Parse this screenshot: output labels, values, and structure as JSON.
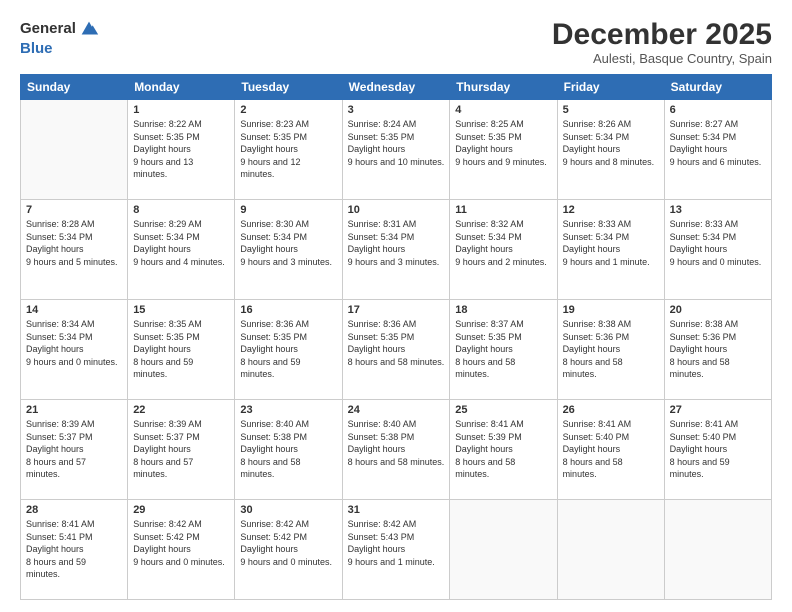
{
  "header": {
    "logo_line1": "General",
    "logo_line2": "Blue",
    "month_title": "December 2025",
    "subtitle": "Aulesti, Basque Country, Spain"
  },
  "weekdays": [
    "Sunday",
    "Monday",
    "Tuesday",
    "Wednesday",
    "Thursday",
    "Friday",
    "Saturday"
  ],
  "weeks": [
    [
      {
        "day": "",
        "sunrise": "",
        "sunset": "",
        "daylight": ""
      },
      {
        "day": "1",
        "sunrise": "8:22 AM",
        "sunset": "5:35 PM",
        "daylight": "9 hours and 13 minutes."
      },
      {
        "day": "2",
        "sunrise": "8:23 AM",
        "sunset": "5:35 PM",
        "daylight": "9 hours and 12 minutes."
      },
      {
        "day": "3",
        "sunrise": "8:24 AM",
        "sunset": "5:35 PM",
        "daylight": "9 hours and 10 minutes."
      },
      {
        "day": "4",
        "sunrise": "8:25 AM",
        "sunset": "5:35 PM",
        "daylight": "9 hours and 9 minutes."
      },
      {
        "day": "5",
        "sunrise": "8:26 AM",
        "sunset": "5:34 PM",
        "daylight": "9 hours and 8 minutes."
      },
      {
        "day": "6",
        "sunrise": "8:27 AM",
        "sunset": "5:34 PM",
        "daylight": "9 hours and 6 minutes."
      }
    ],
    [
      {
        "day": "7",
        "sunrise": "8:28 AM",
        "sunset": "5:34 PM",
        "daylight": "9 hours and 5 minutes."
      },
      {
        "day": "8",
        "sunrise": "8:29 AM",
        "sunset": "5:34 PM",
        "daylight": "9 hours and 4 minutes."
      },
      {
        "day": "9",
        "sunrise": "8:30 AM",
        "sunset": "5:34 PM",
        "daylight": "9 hours and 3 minutes."
      },
      {
        "day": "10",
        "sunrise": "8:31 AM",
        "sunset": "5:34 PM",
        "daylight": "9 hours and 3 minutes."
      },
      {
        "day": "11",
        "sunrise": "8:32 AM",
        "sunset": "5:34 PM",
        "daylight": "9 hours and 2 minutes."
      },
      {
        "day": "12",
        "sunrise": "8:33 AM",
        "sunset": "5:34 PM",
        "daylight": "9 hours and 1 minute."
      },
      {
        "day": "13",
        "sunrise": "8:33 AM",
        "sunset": "5:34 PM",
        "daylight": "9 hours and 0 minutes."
      }
    ],
    [
      {
        "day": "14",
        "sunrise": "8:34 AM",
        "sunset": "5:34 PM",
        "daylight": "9 hours and 0 minutes."
      },
      {
        "day": "15",
        "sunrise": "8:35 AM",
        "sunset": "5:35 PM",
        "daylight": "8 hours and 59 minutes."
      },
      {
        "day": "16",
        "sunrise": "8:36 AM",
        "sunset": "5:35 PM",
        "daylight": "8 hours and 59 minutes."
      },
      {
        "day": "17",
        "sunrise": "8:36 AM",
        "sunset": "5:35 PM",
        "daylight": "8 hours and 58 minutes."
      },
      {
        "day": "18",
        "sunrise": "8:37 AM",
        "sunset": "5:35 PM",
        "daylight": "8 hours and 58 minutes."
      },
      {
        "day": "19",
        "sunrise": "8:38 AM",
        "sunset": "5:36 PM",
        "daylight": "8 hours and 58 minutes."
      },
      {
        "day": "20",
        "sunrise": "8:38 AM",
        "sunset": "5:36 PM",
        "daylight": "8 hours and 58 minutes."
      }
    ],
    [
      {
        "day": "21",
        "sunrise": "8:39 AM",
        "sunset": "5:37 PM",
        "daylight": "8 hours and 57 minutes."
      },
      {
        "day": "22",
        "sunrise": "8:39 AM",
        "sunset": "5:37 PM",
        "daylight": "8 hours and 57 minutes."
      },
      {
        "day": "23",
        "sunrise": "8:40 AM",
        "sunset": "5:38 PM",
        "daylight": "8 hours and 58 minutes."
      },
      {
        "day": "24",
        "sunrise": "8:40 AM",
        "sunset": "5:38 PM",
        "daylight": "8 hours and 58 minutes."
      },
      {
        "day": "25",
        "sunrise": "8:41 AM",
        "sunset": "5:39 PM",
        "daylight": "8 hours and 58 minutes."
      },
      {
        "day": "26",
        "sunrise": "8:41 AM",
        "sunset": "5:40 PM",
        "daylight": "8 hours and 58 minutes."
      },
      {
        "day": "27",
        "sunrise": "8:41 AM",
        "sunset": "5:40 PM",
        "daylight": "8 hours and 59 minutes."
      }
    ],
    [
      {
        "day": "28",
        "sunrise": "8:41 AM",
        "sunset": "5:41 PM",
        "daylight": "8 hours and 59 minutes."
      },
      {
        "day": "29",
        "sunrise": "8:42 AM",
        "sunset": "5:42 PM",
        "daylight": "9 hours and 0 minutes."
      },
      {
        "day": "30",
        "sunrise": "8:42 AM",
        "sunset": "5:42 PM",
        "daylight": "9 hours and 0 minutes."
      },
      {
        "day": "31",
        "sunrise": "8:42 AM",
        "sunset": "5:43 PM",
        "daylight": "9 hours and 1 minute."
      },
      {
        "day": "",
        "sunrise": "",
        "sunset": "",
        "daylight": ""
      },
      {
        "day": "",
        "sunrise": "",
        "sunset": "",
        "daylight": ""
      },
      {
        "day": "",
        "sunrise": "",
        "sunset": "",
        "daylight": ""
      }
    ]
  ]
}
